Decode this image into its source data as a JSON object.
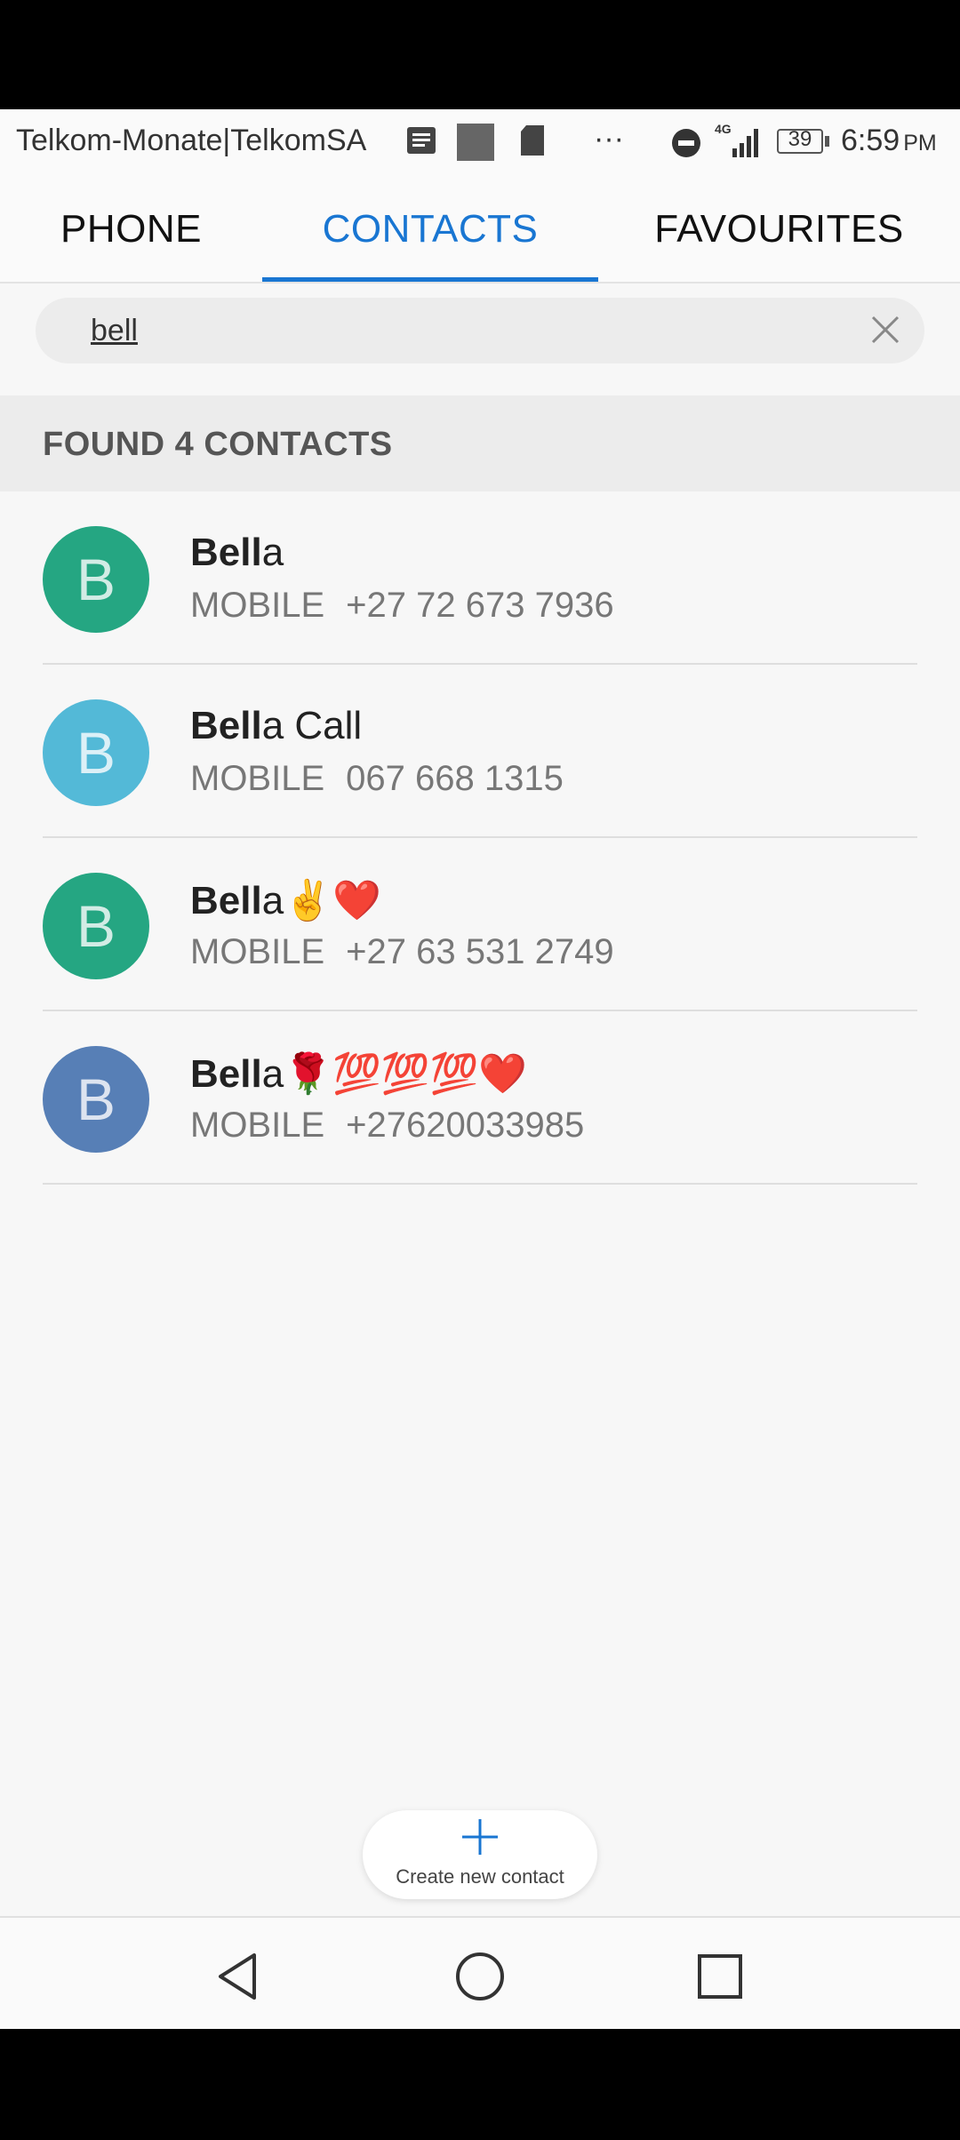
{
  "status_bar": {
    "carrier": "Telkom-Monate|TelkomSA",
    "overflow": "···",
    "network": "4G",
    "battery": "39",
    "time": "6:59",
    "ampm": "PM",
    "icons": [
      "notes-icon",
      "image-icon",
      "sd-card-icon",
      "do-not-disturb-icon",
      "signal-icon",
      "battery-icon"
    ]
  },
  "tabs": [
    {
      "label": "PHONE",
      "active": false
    },
    {
      "label": "CONTACTS",
      "active": true
    },
    {
      "label": "FAVOURITES",
      "active": false
    }
  ],
  "search": {
    "query": "bell"
  },
  "results_header": "FOUND 4 CONTACTS",
  "contacts": [
    {
      "initial": "B",
      "name_match": "Bell",
      "name_rest": "a",
      "phone_label": "MOBILE",
      "phone": "+27 72 673 7936",
      "avatar_color": "#1aa27c"
    },
    {
      "initial": "B",
      "name_match": "Bell",
      "name_rest": "a Call",
      "phone_label": "MOBILE",
      "phone": "067 668 1315",
      "avatar_color": "#4bb6d6"
    },
    {
      "initial": "B",
      "name_match": "Bell",
      "name_rest": "a✌️❤️",
      "phone_label": "MOBILE",
      "phone": "+27 63 531 2749",
      "avatar_color": "#1aa27c"
    },
    {
      "initial": "B",
      "name_match": "Bell",
      "name_rest": "a🌹💯💯💯❤️",
      "phone_label": "MOBILE",
      "phone": "+27620033985",
      "avatar_color": "#4f79b3"
    }
  ],
  "fab": {
    "label": "Create new contact"
  },
  "colors": {
    "accent": "#1976d2",
    "background": "#f7f7f7"
  }
}
